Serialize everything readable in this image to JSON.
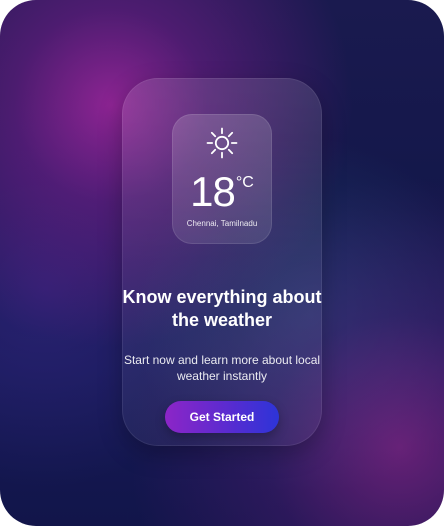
{
  "weather": {
    "icon": "sun-icon",
    "temperature": "18",
    "unit": "°C",
    "location": "Chennai, Tamilnadu"
  },
  "content": {
    "headline": "Know everything about the weather",
    "subtext": "Start now and learn more about local weather instantly",
    "cta_label": "Get Started"
  },
  "theme": {
    "background_primary": "#151a56",
    "accent_start": "#8c25c7",
    "accent_end": "#2d34d8",
    "text_color": "#ffffff"
  }
}
